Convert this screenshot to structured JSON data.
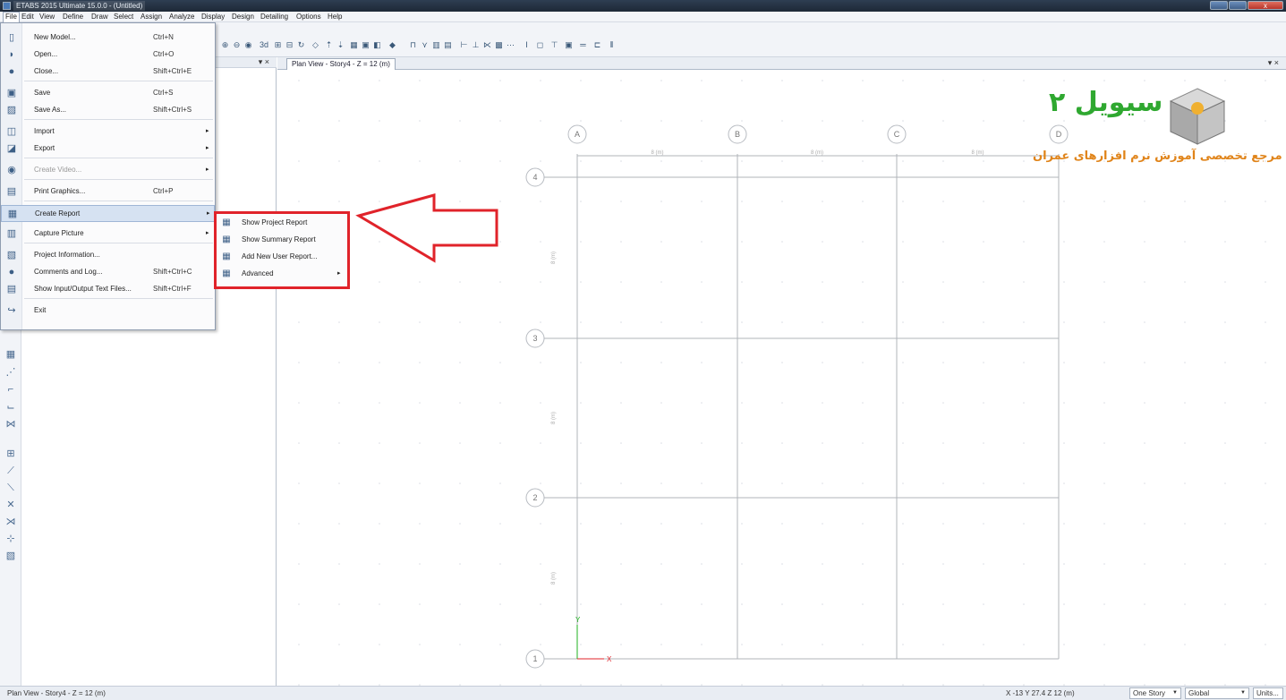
{
  "window": {
    "title": "ETABS 2015 Ultimate 15.0.0 - (Untitled)",
    "close_label": "x"
  },
  "menubar": [
    "File",
    "Edit",
    "View",
    "Define",
    "Draw",
    "Select",
    "Assign",
    "Analyze",
    "Display",
    "Design",
    "Detailing",
    "Options",
    "Help"
  ],
  "file_menu": {
    "items": [
      {
        "label": "New Model...",
        "shortcut": "Ctrl+N",
        "icon": "new-model-icon"
      },
      {
        "label": "Open...",
        "shortcut": "Ctrl+O",
        "icon": "open-icon"
      },
      {
        "label": "Close...",
        "shortcut": "Shift+Ctrl+E",
        "icon": "close-model-icon"
      },
      {
        "label": "Save",
        "shortcut": "Ctrl+S",
        "icon": "save-icon"
      },
      {
        "label": "Save As...",
        "shortcut": "Shift+Ctrl+S",
        "icon": "save-as-icon"
      },
      {
        "label": "Import",
        "shortcut": "",
        "icon": "import-icon"
      },
      {
        "label": "Export",
        "shortcut": "",
        "icon": "export-icon"
      },
      {
        "label": "Create Video...",
        "shortcut": "",
        "icon": "video-icon"
      },
      {
        "label": "Print Graphics...",
        "shortcut": "Ctrl+P",
        "icon": "print-icon"
      },
      {
        "label": "Create Report",
        "shortcut": "",
        "icon": "report-icon"
      },
      {
        "label": "Capture Picture",
        "shortcut": "",
        "icon": "capture-icon"
      },
      {
        "label": "Project Information...",
        "shortcut": "",
        "icon": "project-info-icon"
      },
      {
        "label": "Comments and Log...",
        "shortcut": "Shift+Ctrl+C",
        "icon": "comments-icon"
      },
      {
        "label": "Show Input/Output Text Files...",
        "shortcut": "Shift+Ctrl+F",
        "icon": "text-files-icon"
      },
      {
        "label": "Exit",
        "shortcut": "",
        "icon": "exit-icon"
      }
    ]
  },
  "report_submenu": {
    "items": [
      {
        "label": "Show Project Report"
      },
      {
        "label": "Show Summary Report"
      },
      {
        "label": "Add New User Report..."
      },
      {
        "label": "Advanced"
      }
    ]
  },
  "left_pane": {
    "close_label": "▾ ×"
  },
  "plan_view": {
    "tab_label": "Plan View - Story4 - Z = 12 (m)",
    "close_label": "▾ ×",
    "grid_x": [
      {
        "label": "A"
      },
      {
        "label": "B"
      },
      {
        "label": "C"
      },
      {
        "label": "D"
      }
    ],
    "grid_y": [
      {
        "label": "4"
      },
      {
        "label": "3"
      },
      {
        "label": "2"
      },
      {
        "label": "1"
      }
    ],
    "x_spacing_label": "8 (m)",
    "y_spacing_label": "8 (m)",
    "axis_x_label": "X",
    "axis_y_label": "Y"
  },
  "logo": {
    "title": "سیویل ۲",
    "subtitle": "مرجع تخصصی آموزش نرم افزارهای عمران"
  },
  "statusbar": {
    "left_text": "Plan View - Story4 - Z = 12 (m)",
    "coords": "X -13  Y 27.4  Z 12 (m)",
    "story_select": "One Story",
    "coord_select": "Global",
    "units_label": "Units..."
  }
}
